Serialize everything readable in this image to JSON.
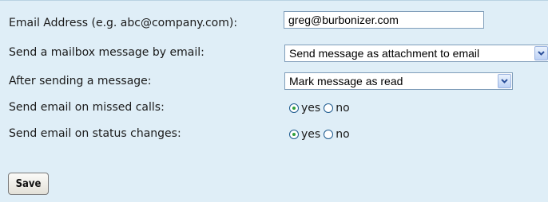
{
  "form": {
    "email": {
      "label": "Email Address (e.g. abc@company.com):",
      "value": "greg@burbonizer.com"
    },
    "mailbox_delivery": {
      "label": "Send a mailbox message by email:",
      "selected": "Send message as attachment to email"
    },
    "after_sending": {
      "label": "After sending a message:",
      "selected": "Mark message as read"
    },
    "missed_calls": {
      "label": "Send email on missed calls:",
      "yes": "yes",
      "no": "no",
      "value": "yes"
    },
    "status_changes": {
      "label": "Send email on status changes:",
      "yes": "yes",
      "no": "no",
      "value": "yes"
    },
    "save_label": "Save"
  },
  "colors": {
    "panel_bg": "#dfeef7",
    "radio_selected": "#2f9f3a",
    "field_border": "#7f9db9"
  },
  "icons": {
    "dropdown": "chevron-down-icon"
  }
}
